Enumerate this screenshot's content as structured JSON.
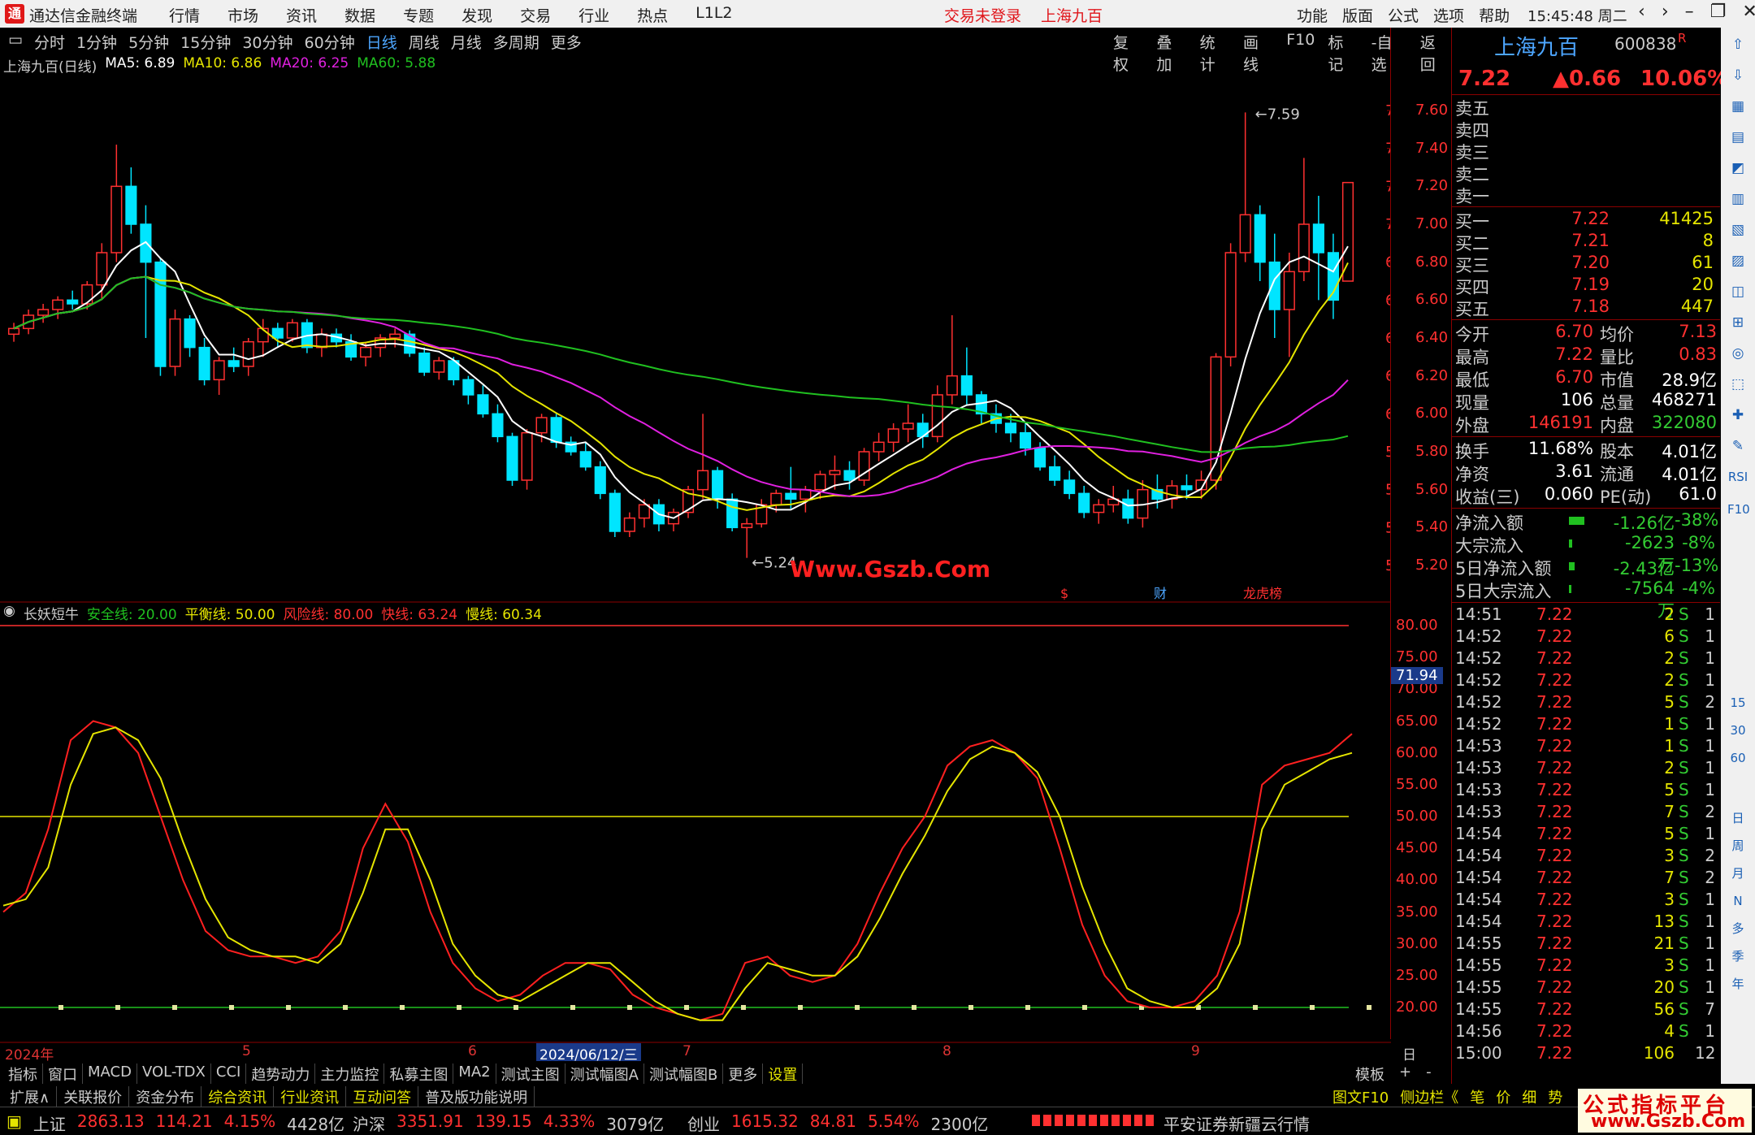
{
  "titlebar": {
    "app_name": "通达信金融终端",
    "menu": [
      "行情",
      "市场",
      "资讯",
      "数据",
      "专题",
      "发现",
      "交易",
      "行业",
      "热点",
      "L1L2"
    ],
    "login_status": "交易未登录",
    "current_stock": "上海九百",
    "right_menu": [
      "功能",
      "版面",
      "公式",
      "选项",
      "帮助"
    ],
    "clock": "15:45:48",
    "weekday": "周二"
  },
  "periods": {
    "items": [
      "分时",
      "1分钟",
      "5分钟",
      "15分钟",
      "30分钟",
      "60分钟",
      "日线",
      "周线",
      "月线",
      "多周期",
      "更多"
    ],
    "selected": "日线",
    "tools": [
      "复权",
      "叠加",
      "统计",
      "画线",
      "F10",
      "标记",
      "-自选",
      "返回"
    ]
  },
  "ma_legend": {
    "title": "上海九百(日线)",
    "ma5": "MA5: 6.89",
    "ma10": "MA10: 6.86",
    "ma20": "MA20: 6.25",
    "ma60": "MA60: 5.88"
  },
  "indicator_legend": {
    "title": "长妖短牛",
    "safe": "安全线: 20.00",
    "balance": "平衡线: 50.00",
    "risk": "风险线: 80.00",
    "fast": "快线: 63.24",
    "slow": "慢线: 60.34"
  },
  "main_axis": [
    "7.60",
    "7.40",
    "7.20",
    "7.00",
    "6.80",
    "6.60",
    "6.40",
    "6.20",
    "6.00",
    "5.80",
    "5.60",
    "5.40",
    "5.20"
  ],
  "ind_axis": [
    "80.00",
    "75.00",
    "70.00",
    "65.00",
    "60.00",
    "55.00",
    "50.00",
    "45.00",
    "40.00",
    "35.00",
    "30.00",
    "25.00",
    "20.00"
  ],
  "ind_current": "71.94",
  "annotations": {
    "high": "7.59",
    "low": "5.24",
    "events": [
      "$",
      "财",
      "龙虎榜"
    ]
  },
  "watermark": "Www.Gszb.Com",
  "dates": {
    "labels": [
      "2024年",
      "5",
      "6",
      "2024/06/12/三",
      "7",
      "8",
      "9"
    ],
    "period_label": "日线"
  },
  "tabs": {
    "items": [
      "指标",
      "窗口",
      "MACD",
      "VOL-TDX",
      "CCI",
      "趋势动力",
      "主力监控",
      "私募主图",
      "MA2",
      "测试主图",
      "测试幅图A",
      "测试幅图B",
      "更多",
      "设置"
    ],
    "selected": "设置",
    "right": [
      "模板",
      "+",
      "-"
    ]
  },
  "extbar": {
    "items": [
      "扩展∧",
      "关联报价",
      "资金分布",
      "综合资讯",
      "行业资讯",
      "互动问答",
      "普及版功能说明"
    ],
    "highlight": [
      "综合资讯",
      "行业资讯",
      "互动问答"
    ],
    "right": [
      "图文F10",
      "侧边栏《",
      "笔",
      "价",
      "细",
      "势"
    ]
  },
  "status": {
    "sh_name": "上证",
    "sh_val": "2863.13",
    "sh_chg": "114.21",
    "sh_pct": "4.15%",
    "sh_amt": "4428亿",
    "hs_name": "沪深",
    "hs_val": "3351.91",
    "hs_chg": "139.15",
    "hs_pct": "4.33%",
    "hs_amt": "3079亿",
    "cy_name": "创业",
    "cy_val": "1615.32",
    "cy_chg": "84.81",
    "cy_pct": "5.54%",
    "cy_amt": "2300亿",
    "broker": "平安证券新疆云行情"
  },
  "quote": {
    "name": "上海九百",
    "code": "600838",
    "badge": "R",
    "price": "7.22",
    "change": "▲0.66",
    "pct": "10.06%",
    "asks": [
      "卖五",
      "卖四",
      "卖三",
      "卖二",
      "卖一"
    ],
    "bids": [
      {
        "label": "买一",
        "price": "7.22",
        "vol": "41425"
      },
      {
        "label": "买二",
        "price": "7.21",
        "vol": "8"
      },
      {
        "label": "买三",
        "price": "7.20",
        "vol": "61"
      },
      {
        "label": "买四",
        "price": "7.19",
        "vol": "20"
      },
      {
        "label": "买五",
        "price": "7.18",
        "vol": "447"
      }
    ],
    "stats": [
      {
        "l1": "今开",
        "v1": "6.70",
        "l2": "均价",
        "v2": "7.13"
      },
      {
        "l1": "最高",
        "v1": "7.22",
        "l2": "量比",
        "v2": "0.83"
      },
      {
        "l1": "最低",
        "v1": "6.70",
        "l2": "市值",
        "v2": "28.9亿"
      },
      {
        "l1": "现量",
        "v1": "106",
        "l2": "总量",
        "v2": "468271"
      },
      {
        "l1": "外盘",
        "v1": "146191",
        "l2": "内盘",
        "v2": "322080"
      }
    ],
    "stats2": [
      {
        "l1": "换手",
        "v1": "11.68%",
        "l2": "股本",
        "v2": "4.01亿"
      },
      {
        "l1": "净资",
        "v1": "3.61",
        "l2": "流通",
        "v2": "4.01亿"
      },
      {
        "l1": "收益(三)",
        "v1": "0.060",
        "l2": "PE(动)",
        "v2": "61.0"
      }
    ],
    "flows": [
      {
        "label": "净流入额",
        "val": "-1.26亿",
        "pct": "-38%",
        "bar": 0.38
      },
      {
        "label": "大宗流入",
        "val": "-2623万",
        "pct": "-8%",
        "bar": 0.08
      },
      {
        "label": "5日净流入额",
        "val": "-2.43亿",
        "pct": "-13%",
        "bar": 0.13
      },
      {
        "label": "5日大宗流入",
        "val": "-7564万",
        "pct": "-4%",
        "bar": 0.04
      }
    ],
    "ticks": [
      {
        "t": "14:51",
        "p": "7.22",
        "v": "2",
        "s": "S",
        "n": "1"
      },
      {
        "t": "14:52",
        "p": "7.22",
        "v": "6",
        "s": "S",
        "n": "1"
      },
      {
        "t": "14:52",
        "p": "7.22",
        "v": "2",
        "s": "S",
        "n": "1"
      },
      {
        "t": "14:52",
        "p": "7.22",
        "v": "2",
        "s": "S",
        "n": "1"
      },
      {
        "t": "14:52",
        "p": "7.22",
        "v": "5",
        "s": "S",
        "n": "2"
      },
      {
        "t": "14:52",
        "p": "7.22",
        "v": "1",
        "s": "S",
        "n": "1"
      },
      {
        "t": "14:53",
        "p": "7.22",
        "v": "1",
        "s": "S",
        "n": "1"
      },
      {
        "t": "14:53",
        "p": "7.22",
        "v": "2",
        "s": "S",
        "n": "1"
      },
      {
        "t": "14:53",
        "p": "7.22",
        "v": "5",
        "s": "S",
        "n": "1"
      },
      {
        "t": "14:53",
        "p": "7.22",
        "v": "7",
        "s": "S",
        "n": "2"
      },
      {
        "t": "14:54",
        "p": "7.22",
        "v": "5",
        "s": "S",
        "n": "1"
      },
      {
        "t": "14:54",
        "p": "7.22",
        "v": "3",
        "s": "S",
        "n": "2"
      },
      {
        "t": "14:54",
        "p": "7.22",
        "v": "7",
        "s": "S",
        "n": "2"
      },
      {
        "t": "14:54",
        "p": "7.22",
        "v": "3",
        "s": "S",
        "n": "1"
      },
      {
        "t": "14:54",
        "p": "7.22",
        "v": "13",
        "s": "S",
        "n": "1"
      },
      {
        "t": "14:55",
        "p": "7.22",
        "v": "21",
        "s": "S",
        "n": "1"
      },
      {
        "t": "14:55",
        "p": "7.22",
        "v": "3",
        "s": "S",
        "n": "1"
      },
      {
        "t": "14:55",
        "p": "7.22",
        "v": "20",
        "s": "S",
        "n": "1"
      },
      {
        "t": "14:55",
        "p": "7.22",
        "v": "56",
        "s": "S",
        "n": "7"
      },
      {
        "t": "14:56",
        "p": "7.22",
        "v": "4",
        "s": "S",
        "n": "1"
      },
      {
        "t": "15:00",
        "p": "7.22",
        "v": "106",
        "s": "",
        "n": "12"
      }
    ]
  },
  "side_toolbar": [
    "日",
    "周",
    "月",
    "N",
    "多",
    "季",
    "年",
    "15",
    "30",
    "60",
    "RSI",
    "F10"
  ],
  "brand": {
    "line1": "公式指标平台",
    "line2": "www.Gszb.Com"
  },
  "colors": {
    "up": "#ff3030",
    "down": "#00e5ff",
    "ma5": "#ffffff",
    "ma10": "#e5e500",
    "ma20": "#e020e0",
    "ma60": "#20c020",
    "blue": "#4da6ff"
  },
  "chart_data": [
    {
      "type": "candlestick",
      "title": "上海九百(日线)",
      "ylim": [
        5.2,
        7.6
      ],
      "series_note": "daily OHLC, approx",
      "ohlc": [
        [
          6.42,
          6.48,
          6.38,
          6.45
        ],
        [
          6.45,
          6.55,
          6.42,
          6.52
        ],
        [
          6.52,
          6.58,
          6.48,
          6.55
        ],
        [
          6.55,
          6.62,
          6.5,
          6.6
        ],
        [
          6.6,
          6.65,
          6.55,
          6.58
        ],
        [
          6.58,
          6.7,
          6.55,
          6.68
        ],
        [
          6.68,
          6.9,
          6.6,
          6.85
        ],
        [
          6.85,
          7.42,
          6.8,
          7.2
        ],
        [
          7.2,
          7.3,
          6.95,
          7.0
        ],
        [
          7.0,
          7.1,
          6.4,
          6.8
        ],
        [
          6.8,
          6.82,
          6.2,
          6.25
        ],
        [
          6.25,
          6.55,
          6.2,
          6.5
        ],
        [
          6.5,
          6.52,
          6.3,
          6.35
        ],
        [
          6.35,
          6.4,
          6.15,
          6.18
        ],
        [
          6.18,
          6.3,
          6.1,
          6.28
        ],
        [
          6.28,
          6.35,
          6.22,
          6.25
        ],
        [
          6.25,
          6.4,
          6.2,
          6.38
        ],
        [
          6.38,
          6.5,
          6.3,
          6.45
        ],
        [
          6.45,
          6.48,
          6.35,
          6.4
        ],
        [
          6.4,
          6.5,
          6.38,
          6.48
        ],
        [
          6.48,
          6.5,
          6.32,
          6.35
        ],
        [
          6.35,
          6.45,
          6.3,
          6.42
        ],
        [
          6.42,
          6.45,
          6.35,
          6.38
        ],
        [
          6.38,
          6.42,
          6.28,
          6.3
        ],
        [
          6.3,
          6.38,
          6.25,
          6.35
        ],
        [
          6.35,
          6.42,
          6.3,
          6.4
        ],
        [
          6.4,
          6.45,
          6.35,
          6.42
        ],
        [
          6.42,
          6.44,
          6.3,
          6.32
        ],
        [
          6.32,
          6.35,
          6.2,
          6.22
        ],
        [
          6.22,
          6.3,
          6.18,
          6.28
        ],
        [
          6.28,
          6.3,
          6.15,
          6.18
        ],
        [
          6.18,
          6.2,
          6.05,
          6.1
        ],
        [
          6.1,
          6.15,
          5.98,
          6.0
        ],
        [
          6.0,
          6.05,
          5.85,
          5.88
        ],
        [
          5.88,
          5.9,
          5.62,
          5.65
        ],
        [
          5.65,
          5.92,
          5.6,
          5.9
        ],
        [
          5.9,
          6.0,
          5.85,
          5.98
        ],
        [
          5.98,
          6.0,
          5.82,
          5.85
        ],
        [
          5.85,
          5.88,
          5.78,
          5.8
        ],
        [
          5.8,
          5.85,
          5.7,
          5.72
        ],
        [
          5.72,
          5.75,
          5.55,
          5.58
        ],
        [
          5.58,
          5.6,
          5.35,
          5.38
        ],
        [
          5.38,
          5.48,
          5.35,
          5.45
        ],
        [
          5.45,
          5.55,
          5.4,
          5.52
        ],
        [
          5.52,
          5.55,
          5.38,
          5.42
        ],
        [
          5.42,
          5.5,
          5.38,
          5.48
        ],
        [
          5.48,
          5.62,
          5.45,
          5.6
        ],
        [
          5.6,
          6.0,
          5.55,
          5.7
        ],
        [
          5.7,
          5.72,
          5.5,
          5.55
        ],
        [
          5.55,
          5.58,
          5.38,
          5.4
        ],
        [
          5.4,
          5.45,
          5.24,
          5.42
        ],
        [
          5.42,
          5.55,
          5.4,
          5.52
        ],
        [
          5.52,
          5.6,
          5.48,
          5.58
        ],
        [
          5.58,
          5.72,
          5.5,
          5.55
        ],
        [
          5.55,
          5.62,
          5.48,
          5.6
        ],
        [
          5.6,
          5.7,
          5.55,
          5.68
        ],
        [
          5.68,
          5.78,
          5.6,
          5.7
        ],
        [
          5.7,
          5.75,
          5.6,
          5.65
        ],
        [
          5.65,
          5.82,
          5.62,
          5.8
        ],
        [
          5.8,
          5.9,
          5.75,
          5.85
        ],
        [
          5.85,
          5.95,
          5.8,
          5.92
        ],
        [
          5.92,
          6.05,
          5.85,
          5.95
        ],
        [
          5.95,
          6.0,
          5.82,
          5.88
        ],
        [
          5.88,
          6.15,
          5.85,
          6.1
        ],
        [
          6.1,
          6.52,
          6.05,
          6.2
        ],
        [
          6.2,
          6.35,
          6.05,
          6.1
        ],
        [
          6.1,
          6.12,
          5.95,
          6.0
        ],
        [
          6.0,
          6.05,
          5.9,
          5.95
        ],
        [
          5.95,
          6.0,
          5.85,
          5.9
        ],
        [
          5.9,
          5.95,
          5.78,
          5.82
        ],
        [
          5.82,
          5.85,
          5.7,
          5.72
        ],
        [
          5.72,
          5.78,
          5.62,
          5.65
        ],
        [
          5.65,
          5.7,
          5.55,
          5.58
        ],
        [
          5.58,
          5.62,
          5.45,
          5.48
        ],
        [
          5.48,
          5.55,
          5.42,
          5.52
        ],
        [
          5.52,
          5.62,
          5.48,
          5.55
        ],
        [
          5.55,
          5.6,
          5.42,
          5.45
        ],
        [
          5.45,
          5.65,
          5.4,
          5.6
        ],
        [
          5.6,
          5.68,
          5.5,
          5.55
        ],
        [
          5.55,
          5.65,
          5.5,
          5.62
        ],
        [
          5.62,
          5.68,
          5.55,
          5.6
        ],
        [
          5.6,
          5.7,
          5.55,
          5.65
        ],
        [
          5.65,
          6.32,
          5.6,
          6.3
        ],
        [
          6.3,
          6.9,
          6.25,
          6.85
        ],
        [
          6.85,
          7.59,
          6.8,
          7.05
        ],
        [
          7.05,
          7.1,
          6.7,
          6.8
        ],
        [
          6.8,
          6.95,
          6.4,
          6.55
        ],
        [
          6.55,
          6.85,
          6.3,
          6.75
        ],
        [
          6.75,
          7.35,
          6.7,
          7.0
        ],
        [
          7.0,
          7.15,
          6.6,
          6.85
        ],
        [
          6.85,
          6.95,
          6.5,
          6.6
        ],
        [
          6.7,
          7.22,
          6.7,
          7.22
        ]
      ]
    },
    {
      "type": "line",
      "title": "长妖短牛",
      "ylim": [
        17,
        82
      ],
      "series": [
        {
          "name": "快线",
          "values": [
            35,
            38,
            48,
            62,
            65,
            64,
            60,
            50,
            40,
            32,
            29,
            28,
            28,
            27,
            28,
            32,
            45,
            52,
            46,
            35,
            27,
            23,
            21,
            22,
            25,
            27,
            27,
            26,
            22,
            20,
            19,
            18,
            19,
            27,
            28,
            25,
            24,
            25,
            30,
            38,
            45,
            50,
            58,
            61,
            62,
            60,
            56,
            45,
            33,
            25,
            21,
            20,
            20,
            21,
            25,
            35,
            55,
            58,
            59,
            60,
            63
          ]
        },
        {
          "name": "慢线",
          "values": [
            36,
            37,
            42,
            55,
            63,
            64,
            62,
            56,
            46,
            37,
            31,
            29,
            28,
            28,
            27,
            30,
            38,
            48,
            48,
            40,
            30,
            25,
            22,
            21,
            23,
            25,
            27,
            27,
            24,
            21,
            19,
            18,
            18,
            23,
            27,
            26,
            25,
            25,
            28,
            34,
            41,
            47,
            54,
            59,
            61,
            60,
            57,
            50,
            39,
            30,
            23,
            21,
            20,
            20,
            23,
            30,
            48,
            55,
            57,
            59,
            60
          ]
        }
      ],
      "reference_lines": [
        20,
        50,
        80
      ]
    }
  ]
}
